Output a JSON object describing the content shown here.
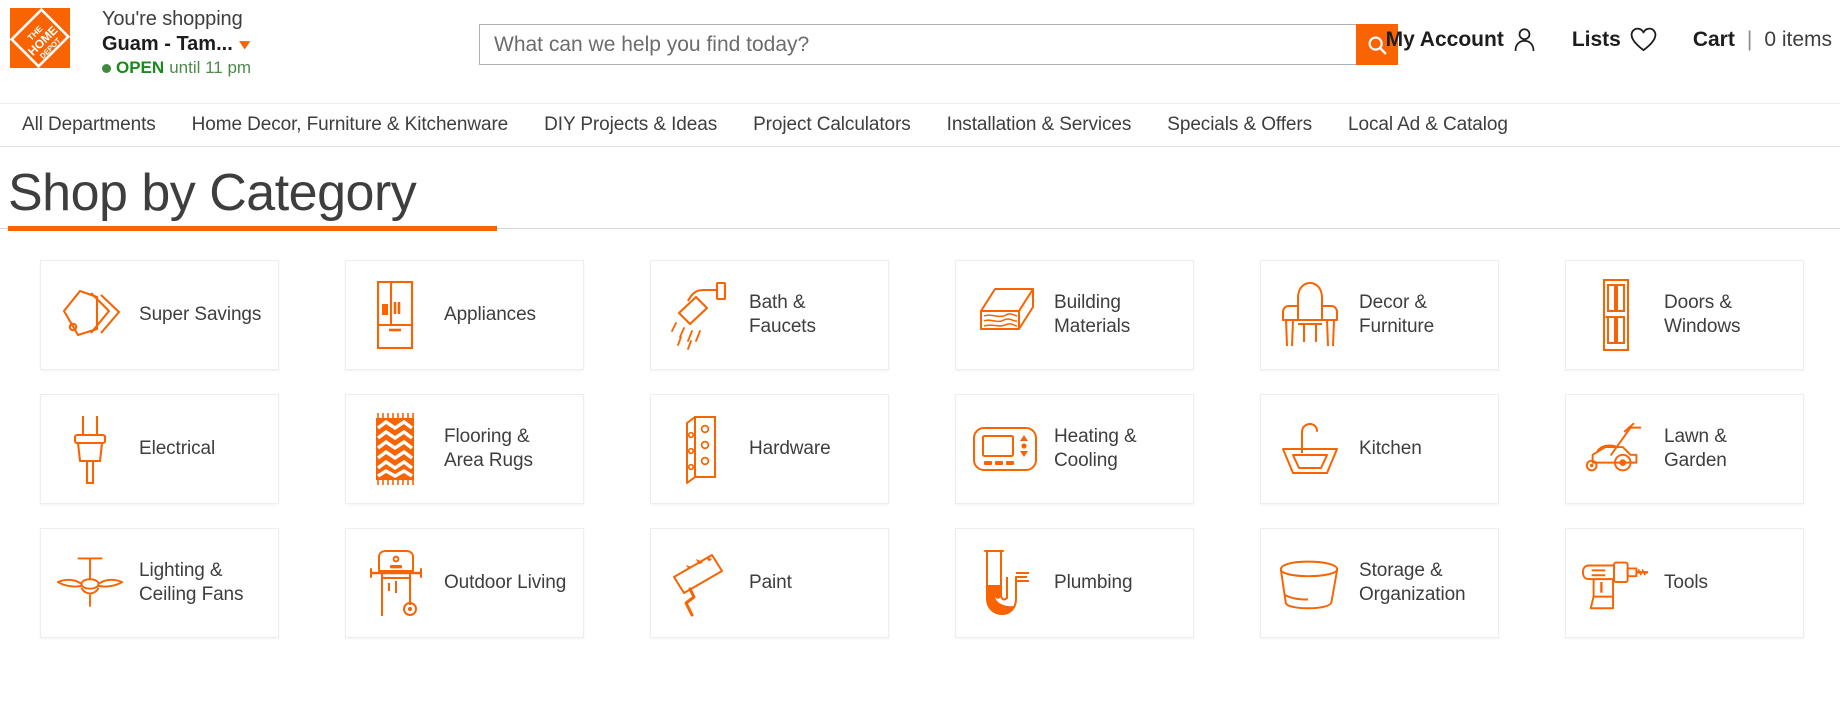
{
  "header": {
    "logo_alt": "The Home Depot",
    "store": {
      "shopping_label": "You're shopping",
      "store_name": "Guam - Tam...",
      "status_bold": "OPEN",
      "status_rest": "until 11 pm"
    },
    "search": {
      "placeholder": "What can we help you find today?",
      "value": "",
      "button_icon": "search-icon"
    },
    "account": {
      "label": "My Account",
      "icon": "person-icon"
    },
    "lists": {
      "label": "Lists",
      "icon": "heart-icon"
    },
    "cart": {
      "label": "Cart",
      "separator": "|",
      "count_label": "0 items"
    }
  },
  "nav": {
    "items": [
      {
        "label": "All Departments"
      },
      {
        "label": "Home Decor, Furniture & Kitchenware"
      },
      {
        "label": "DIY Projects & Ideas"
      },
      {
        "label": "Project Calculators"
      },
      {
        "label": "Installation & Services"
      },
      {
        "label": "Specials & Offers"
      },
      {
        "label": "Local Ad & Catalog"
      }
    ]
  },
  "main": {
    "title": "Shop by Category",
    "categories": [
      {
        "label": "Super Savings",
        "icon": "price-tags-icon"
      },
      {
        "label": "Appliances",
        "icon": "refrigerator-icon"
      },
      {
        "label": "Bath & Faucets",
        "icon": "showerhead-icon"
      },
      {
        "label": "Building Materials",
        "icon": "lumber-icon"
      },
      {
        "label": "Decor & Furniture",
        "icon": "armchair-icon"
      },
      {
        "label": "Doors & Windows",
        "icon": "door-icon"
      },
      {
        "label": "Electrical",
        "icon": "plug-icon"
      },
      {
        "label": "Flooring & Area Rugs",
        "icon": "area-rug-icon"
      },
      {
        "label": "Hardware",
        "icon": "hinge-icon"
      },
      {
        "label": "Heating & Cooling",
        "icon": "thermostat-icon"
      },
      {
        "label": "Kitchen",
        "icon": "sink-icon"
      },
      {
        "label": "Lawn & Garden",
        "icon": "lawn-mower-icon"
      },
      {
        "label": "Lighting & Ceiling Fans",
        "icon": "ceiling-fan-icon"
      },
      {
        "label": "Outdoor Living",
        "icon": "grill-icon"
      },
      {
        "label": "Paint",
        "icon": "paint-roller-icon"
      },
      {
        "label": "Plumbing",
        "icon": "p-trap-pipe-icon"
      },
      {
        "label": "Storage & Organization",
        "icon": "storage-bin-icon"
      },
      {
        "label": "Tools",
        "icon": "power-drill-icon"
      }
    ]
  },
  "colors": {
    "brand_orange": "#f96302",
    "open_green": "#1a8a1a",
    "text_dark": "#3e3e3e"
  }
}
